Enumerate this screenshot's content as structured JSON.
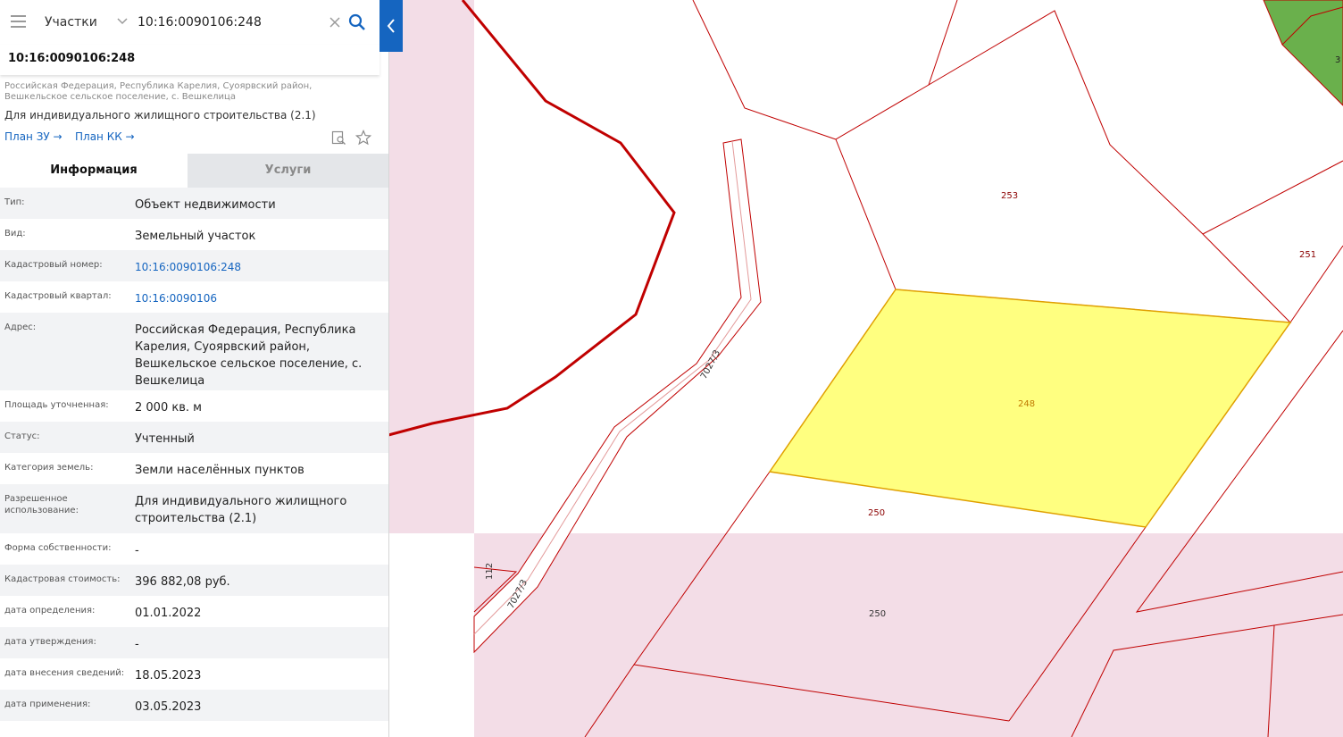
{
  "search": {
    "layer": "Участки",
    "query": "10:16:0090106:248"
  },
  "result": {
    "title": "10:16:0090106:248",
    "address": "Российская Федерация, Республика Карелия, Суоярвский район, Вешкельское сельское поселение, с. Вешкелица",
    "use": "Для индивидуального жилищного строительства (2.1)",
    "plan_zu": "План ЗУ →",
    "plan_kk": "План КК →"
  },
  "tabs": {
    "info": "Информация",
    "services": "Услуги"
  },
  "info": {
    "type_label": "Тип:",
    "type_value": "Объект недвижимости",
    "kind_label": "Вид:",
    "kind_value": "Земельный участок",
    "cadnum_label": "Кадастровый номер:",
    "cadnum_value": "10:16:0090106:248",
    "quarter_label": "Кадастровый квартал:",
    "quarter_value": "10:16:0090106",
    "address_label": "Адрес:",
    "address_value": "Российская Федерация, Республика Карелия, Суоярвский район, Вешкельское сельское поселение, с. Вешкелица",
    "area_label": "Площадь уточненная:",
    "area_value": "2 000 кв. м",
    "status_label": "Статус:",
    "status_value": "Учтенный",
    "category_label": "Категория земель:",
    "category_value": "Земли населённых пунктов",
    "permitted_label": "Разрешенное использование:",
    "permitted_value": "Для индивидуального жилищного строительства (2.1)",
    "ownership_label": "Форма собственности:",
    "ownership_value": "-",
    "cost_label": "Кадастровая стоимость:",
    "cost_value": "396 882,08 руб.",
    "det_date_label": "дата определения:",
    "det_date_value": "01.01.2022",
    "appr_date_label": "дата утверждения:",
    "appr_date_value": "-",
    "entry_date_label": "дата внесения сведений:",
    "entry_date_value": "18.05.2023",
    "apply_date_label": "дата применения:",
    "apply_date_value": "03.05.2023"
  },
  "map": {
    "labels": {
      "p253": "253",
      "p251": "251",
      "p248": "248",
      "p250a": "250",
      "p250b": "250",
      "road_top": "7027/3",
      "road_bottom": "7027/3",
      "p112": "112",
      "p3x": "3"
    },
    "colors": {
      "border": "#c00000",
      "selected_fill": "#ffff80",
      "selected_border": "#e0a000",
      "zone_fill": "#f3dde7",
      "forest_fill": "#6ab04c",
      "accent": "#1565c0"
    }
  }
}
